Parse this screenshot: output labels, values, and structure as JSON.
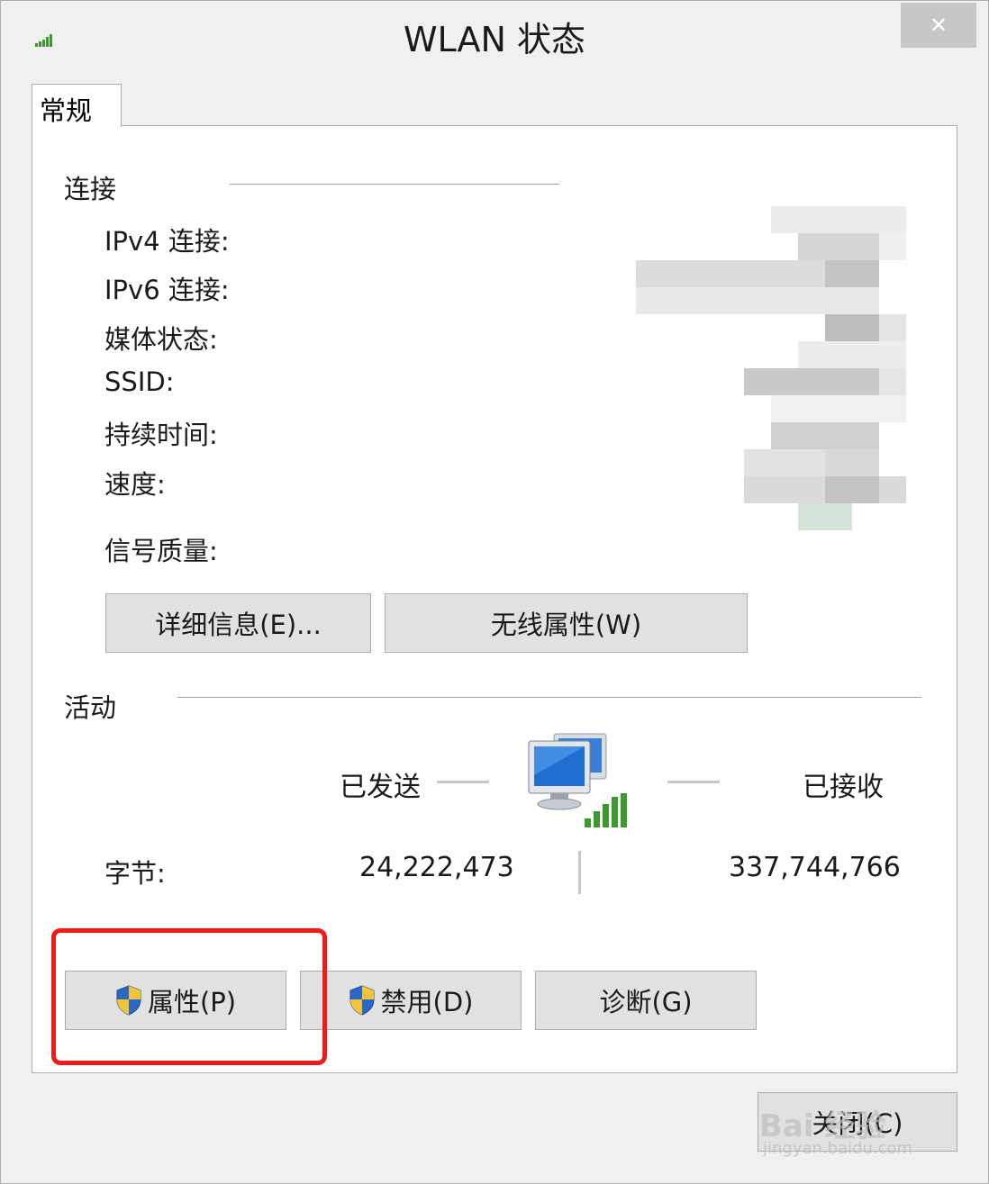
{
  "window": {
    "title": "WLAN 状态",
    "close_glyph": "✕"
  },
  "tab": {
    "label": "常规"
  },
  "connection": {
    "group_title": "连接",
    "labels": [
      "IPv4 连接:",
      "IPv6 连接:",
      "媒体状态:",
      "SSID:",
      "持续时间:",
      "速度:",
      "信号质量:"
    ],
    "buttons": {
      "details": "详细信息(E)...",
      "wireless": "无线属性(W)"
    }
  },
  "activity": {
    "group_title": "活动",
    "sent_label": "已发送",
    "received_label": "已接收",
    "bytes_label": "字节:",
    "bytes_sent": "24,222,473",
    "bytes_received": "337,744,766"
  },
  "actions": {
    "properties": "属性(P)",
    "disable": "禁用(D)",
    "diagnose": "诊断(G)",
    "close": "关闭(C)"
  },
  "icons": [
    "wifi-signal-icon",
    "network-computer-icon",
    "uac-shield-icon"
  ],
  "colors": {
    "highlight": "#ee1b1b",
    "signal_green": "#3a9a2c"
  },
  "watermark": {
    "brand": "Bai 经验",
    "url": "jingyan.baidu.com"
  }
}
